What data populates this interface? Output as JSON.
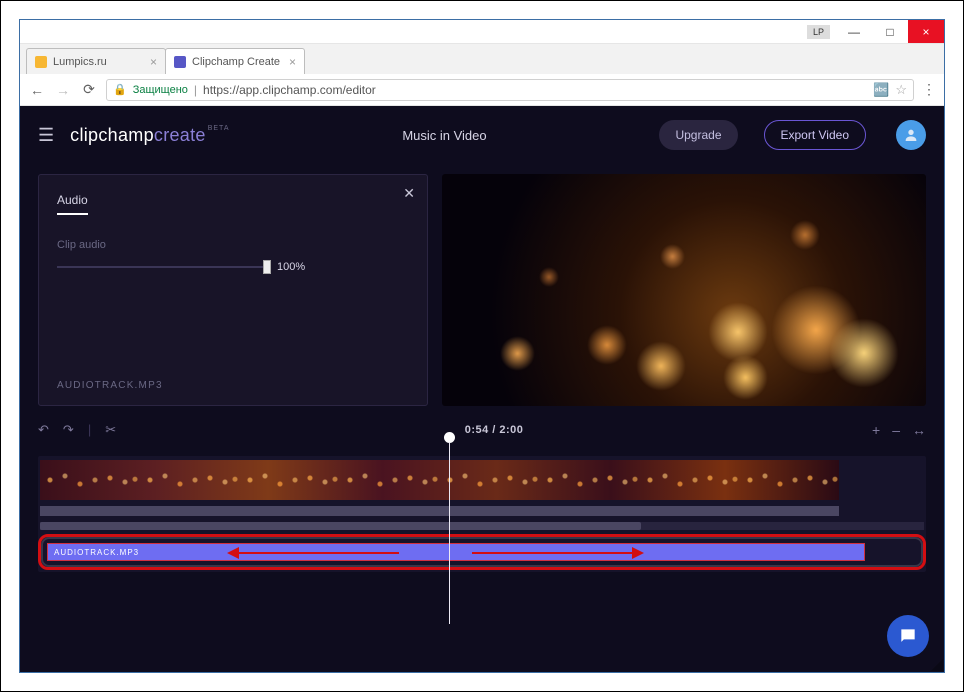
{
  "window": {
    "lp_badge": "LP",
    "minimize": "—",
    "maximize": "□",
    "close": "×"
  },
  "tabs": [
    {
      "label": "Lumpics.ru",
      "favicon_bg": "#f7b733",
      "active": false,
      "close": "×"
    },
    {
      "label": "Clipchamp Create",
      "favicon_bg": "#5757c6",
      "active": true,
      "close": "×"
    }
  ],
  "addressbar": {
    "back": "←",
    "forward": "→",
    "reload": "⟳",
    "secure_label": "Защищено",
    "url_scheme": "https://",
    "url_host": "app.clipchamp.com",
    "url_path": "/editor",
    "star": "☆",
    "translate": "⌨",
    "menu": "⋮"
  },
  "header": {
    "logo_part1": "clipchamp",
    "logo_part2": "create",
    "logo_beta": "BETA",
    "project_title": "Music in Video",
    "upgrade": "Upgrade",
    "export": "Export Video"
  },
  "panel": {
    "tab_label": "Audio",
    "clip_audio_label": "Clip audio",
    "volume_value": "100%",
    "filename": "AUDIOTRACK.MP3",
    "close": "✕"
  },
  "timeline_tools": {
    "undo": "↶",
    "redo": "↷",
    "cut": "✂",
    "time_display": "0:54 / 2:00",
    "add": "+",
    "zoom_out": "–",
    "zoom_fit": "↔"
  },
  "timeline": {
    "audio_clip_label": "AUDIOTRACK.MP3"
  },
  "colors": {
    "accent": "#6a56d4",
    "bg_dark": "#0e0c1e",
    "highlight": "#d30e12",
    "audio_track": "#6e6df2"
  }
}
